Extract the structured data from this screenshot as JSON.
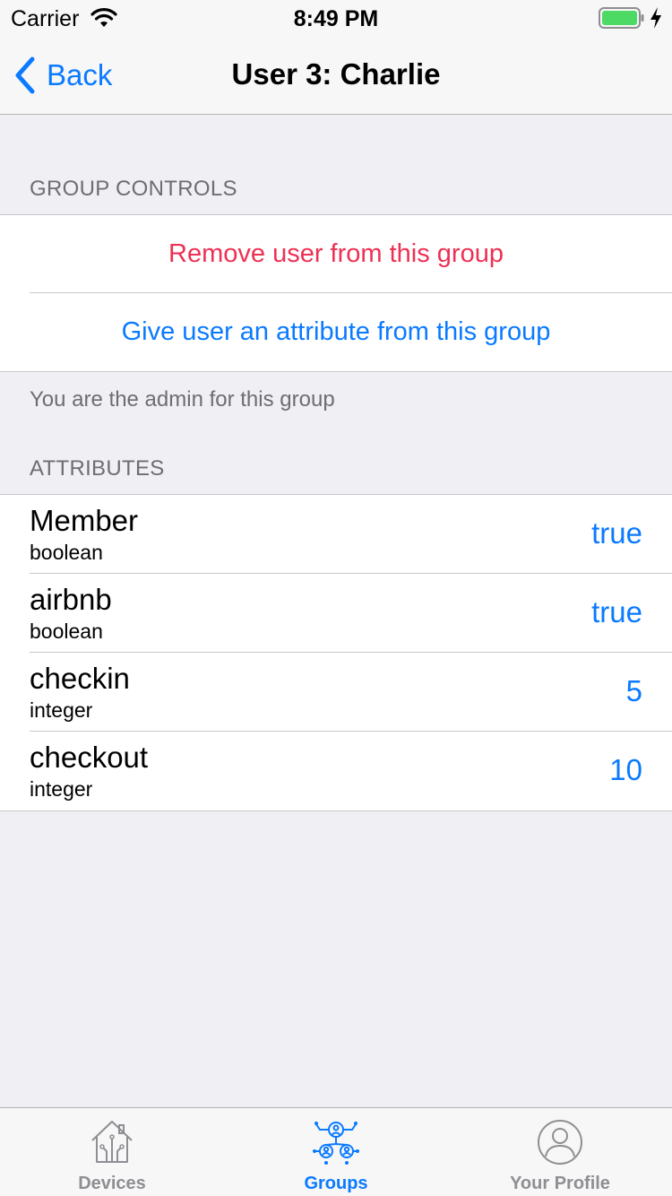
{
  "status_bar": {
    "carrier": "Carrier",
    "time": "8:49 PM",
    "battery_color": "#4cd964"
  },
  "nav": {
    "back_label": "Back",
    "title": "User 3: Charlie"
  },
  "group_controls": {
    "header": "GROUP CONTROLS",
    "remove_label": "Remove user from this group",
    "give_attribute_label": "Give user an attribute from this group",
    "footer": "You are the admin for this group"
  },
  "attributes": {
    "header": "ATTRIBUTES",
    "items": [
      {
        "name": "Member",
        "type": "boolean",
        "value": "true"
      },
      {
        "name": "airbnb",
        "type": "boolean",
        "value": "true"
      },
      {
        "name": "checkin",
        "type": "integer",
        "value": "5"
      },
      {
        "name": "checkout",
        "type": "integer",
        "value": "10"
      }
    ]
  },
  "tab_bar": {
    "items": [
      {
        "label": "Devices",
        "icon": "house-circuit-icon",
        "active": false
      },
      {
        "label": "Groups",
        "icon": "groups-network-icon",
        "active": true
      },
      {
        "label": "Your Profile",
        "icon": "profile-person-icon",
        "active": false
      }
    ]
  },
  "colors": {
    "accent": "#0a7aff",
    "destructive": "#ee3053",
    "background": "#efeff4"
  }
}
